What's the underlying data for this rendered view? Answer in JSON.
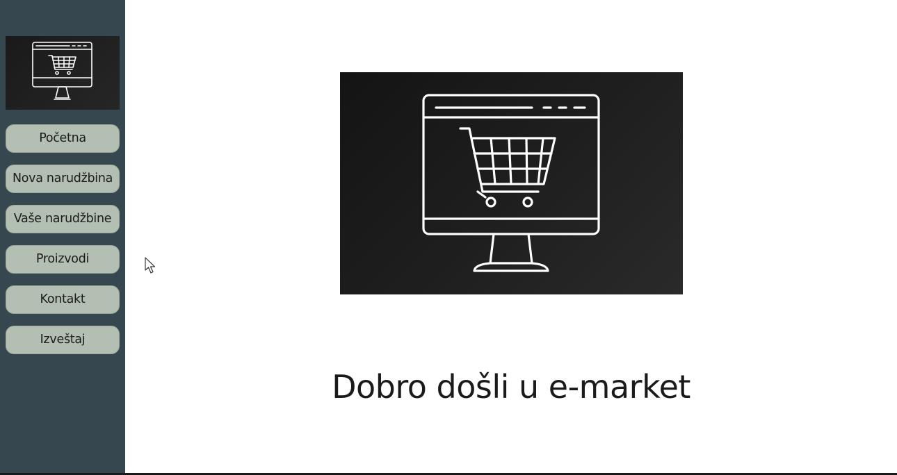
{
  "sidebar": {
    "logo_icon": "shopping-cart-monitor-icon",
    "items": [
      {
        "label": "Početna"
      },
      {
        "label": "Nova narudžbina"
      },
      {
        "label": "Vaše narudžbine"
      },
      {
        "label": "Proizvodi"
      },
      {
        "label": "Kontakt"
      },
      {
        "label": "Izveštaj"
      }
    ]
  },
  "main": {
    "hero_icon": "shopping-cart-monitor-icon",
    "welcome_text": "Dobro došli u e-market"
  },
  "colors": {
    "sidebar_bg": "#37474f",
    "button_bg": "#b2bfb2",
    "image_bg": "#1a1a1a",
    "text": "#1a1a1a"
  }
}
